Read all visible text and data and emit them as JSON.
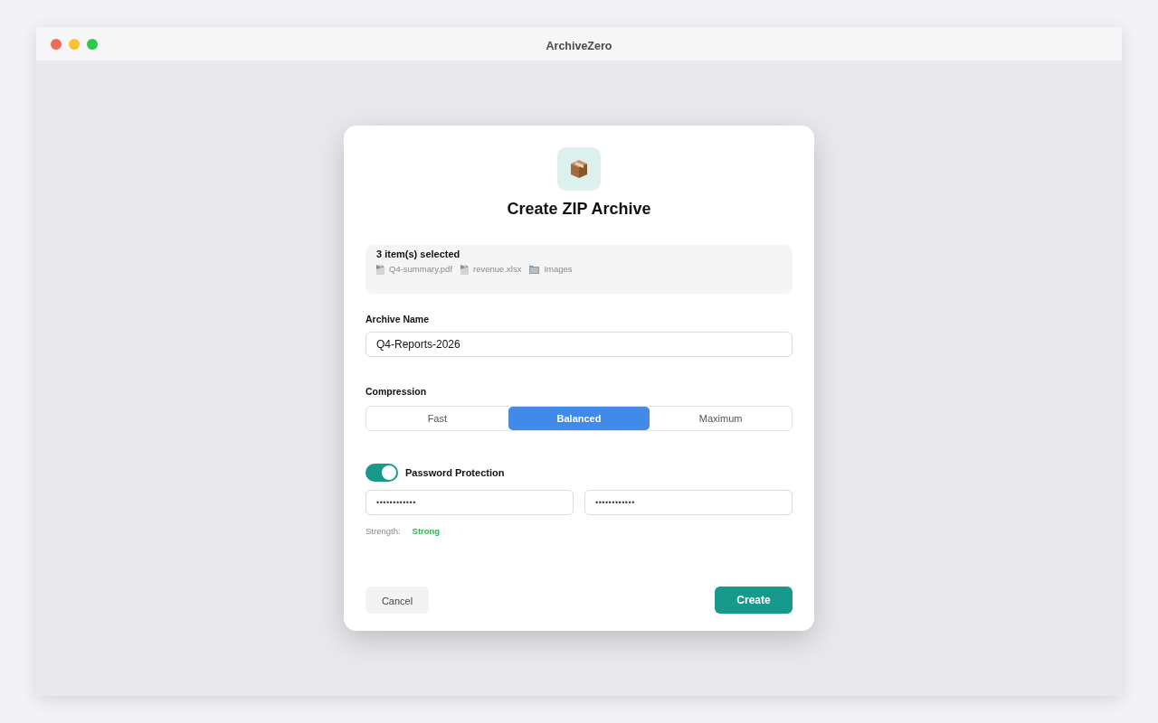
{
  "window": {
    "title": "ArchiveZero"
  },
  "dialog": {
    "title": "Create ZIP Archive",
    "selection": {
      "summary": "3 item(s) selected",
      "items": [
        {
          "kind": "file",
          "name": "Q4-summary.pdf"
        },
        {
          "kind": "file",
          "name": "revenue.xlsx"
        },
        {
          "kind": "folder",
          "name": "Images"
        }
      ]
    },
    "archive_name": {
      "label": "Archive Name",
      "value": "Q4-Reports-2026"
    },
    "compression": {
      "label": "Compression",
      "options": [
        {
          "label": "Fast",
          "selected": false
        },
        {
          "label": "Balanced",
          "selected": true
        },
        {
          "label": "Maximum",
          "selected": false
        }
      ]
    },
    "password": {
      "label": "Password Protection",
      "on": true,
      "fields": [
        {
          "value": "••••••••••••"
        },
        {
          "value": "••••••••••••"
        }
      ],
      "strength_label": "Strength:",
      "strength": "Strong"
    },
    "buttons": [
      {
        "kind": "secondary",
        "label": "Cancel"
      },
      {
        "kind": "primary",
        "label": "Create"
      }
    ]
  }
}
